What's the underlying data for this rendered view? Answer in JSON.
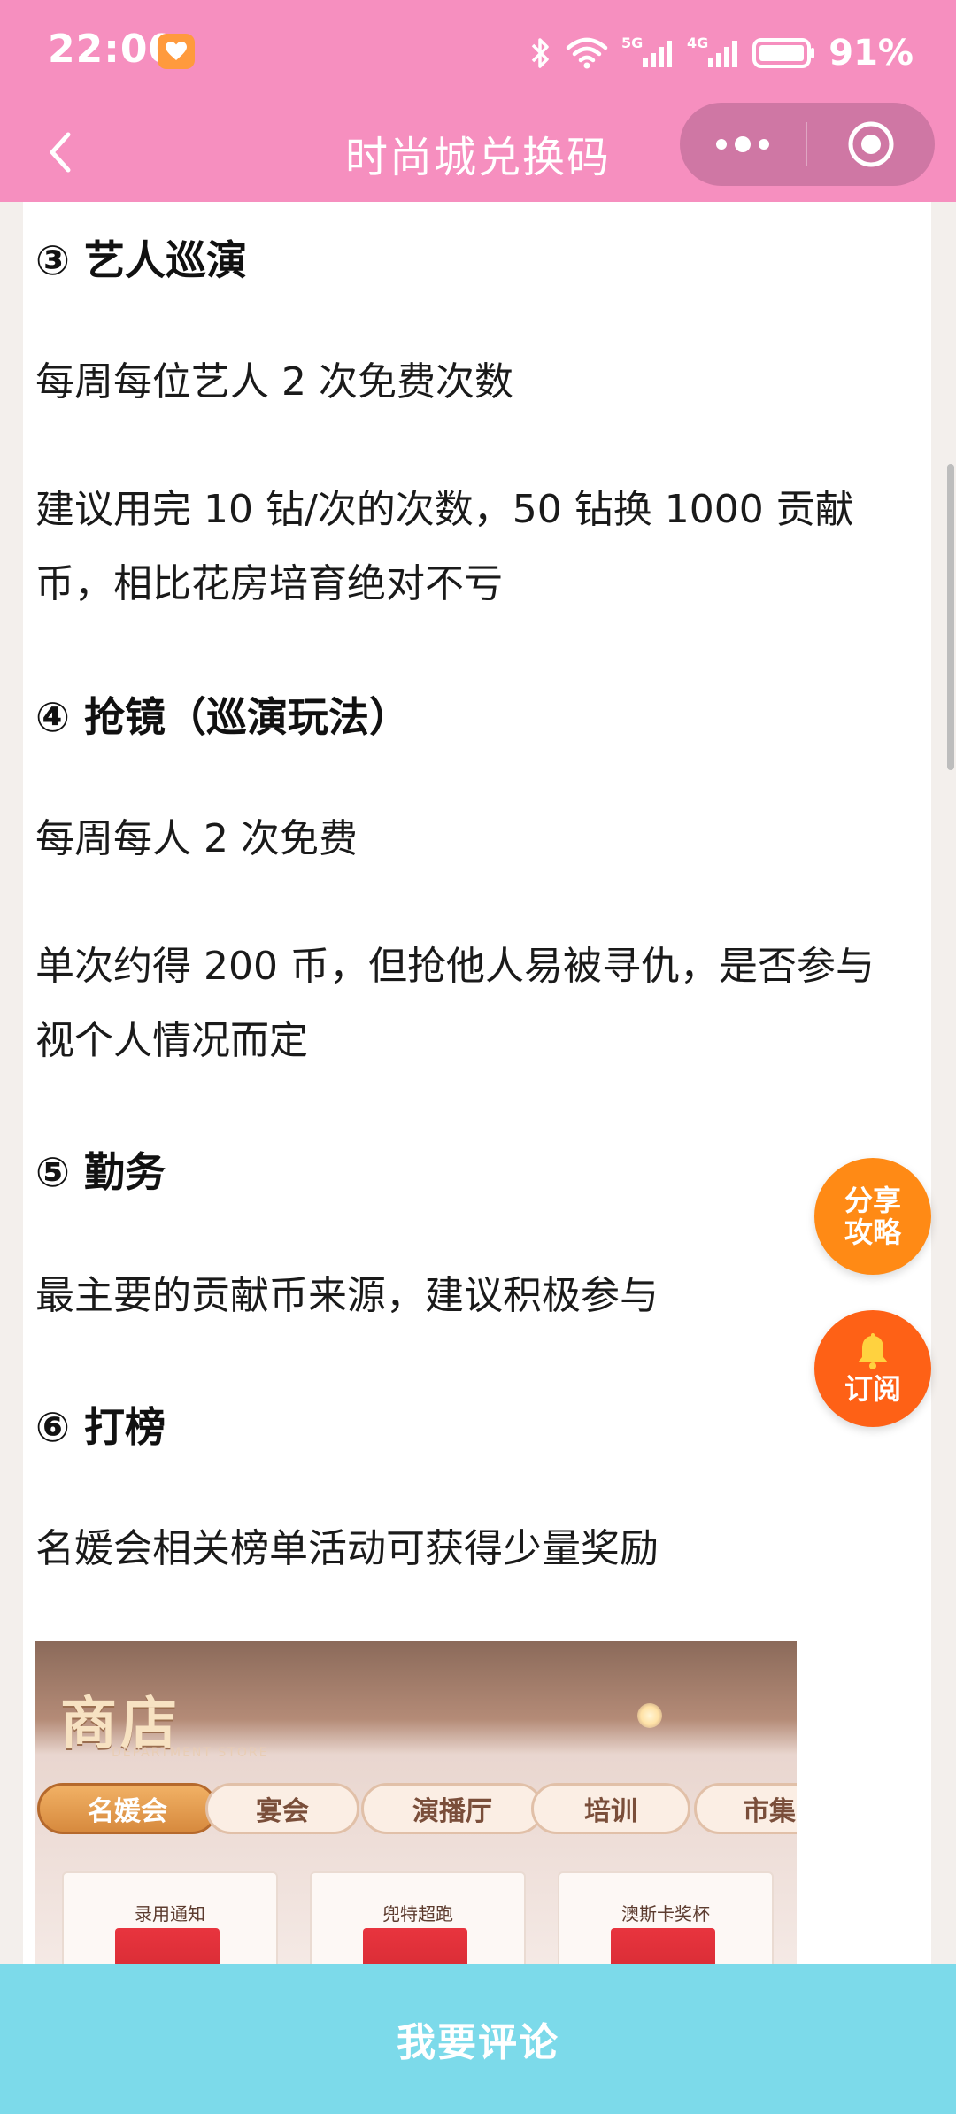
{
  "status_bar": {
    "time": "22:00",
    "battery_percent": "91%",
    "network_1": "5G",
    "network_2": "4G",
    "icons": [
      "heart-app-icon",
      "bluetooth-icon",
      "wifi-icon",
      "signal-5g-icon",
      "signal-4g-icon",
      "battery-icon"
    ]
  },
  "navbar": {
    "title": "时尚城兑换码",
    "back_icon": "chevron-left-icon",
    "more_icon": "more-dots-icon",
    "close_icon": "target-circle-icon"
  },
  "article": {
    "sections": [
      {
        "heading": "③ 艺人巡演",
        "paragraphs": [
          "每周每位艺人 2 次免费次数",
          "建议用完 10 钻/次的次数，50 钻换 1000 贡献币，相比花房培育绝对不亏"
        ]
      },
      {
        "heading": "④ 抢镜（巡演玩法）",
        "paragraphs": [
          "每周每人 2 次免费",
          "单次约得 200 币，但抢他人易被寻仇，是否参与视个人情况而定"
        ]
      },
      {
        "heading": "⑤ 勤务",
        "paragraphs": [
          "最主要的贡献币来源，建议积极参与"
        ]
      },
      {
        "heading": "⑥ 打榜",
        "paragraphs": [
          "名媛会相关榜单活动可获得少量奖励"
        ]
      }
    ],
    "image": {
      "shop_title": "商店",
      "shop_subtitle": "DEPARTMENT STORE",
      "tabs": [
        "名媛会",
        "宴会",
        "演播厅",
        "培训",
        "市集"
      ],
      "active_tab": "名媛会",
      "cards": [
        "录用通知",
        "兜特超跑",
        "澳斯卡奖杯"
      ]
    }
  },
  "fabs": {
    "share_line1": "分享",
    "share_line2": "攻略",
    "subscribe_label": "订阅",
    "subscribe_icon": "bell-icon"
  },
  "comment_bar": {
    "label": "我要评论"
  },
  "colors": {
    "header_pink": "#f68fbf",
    "capsule_pink": "#cf77a4",
    "share_orange": "#ff8a15",
    "subscribe_orange": "#fe6116",
    "comment_bar_blue": "#7cdaea"
  }
}
